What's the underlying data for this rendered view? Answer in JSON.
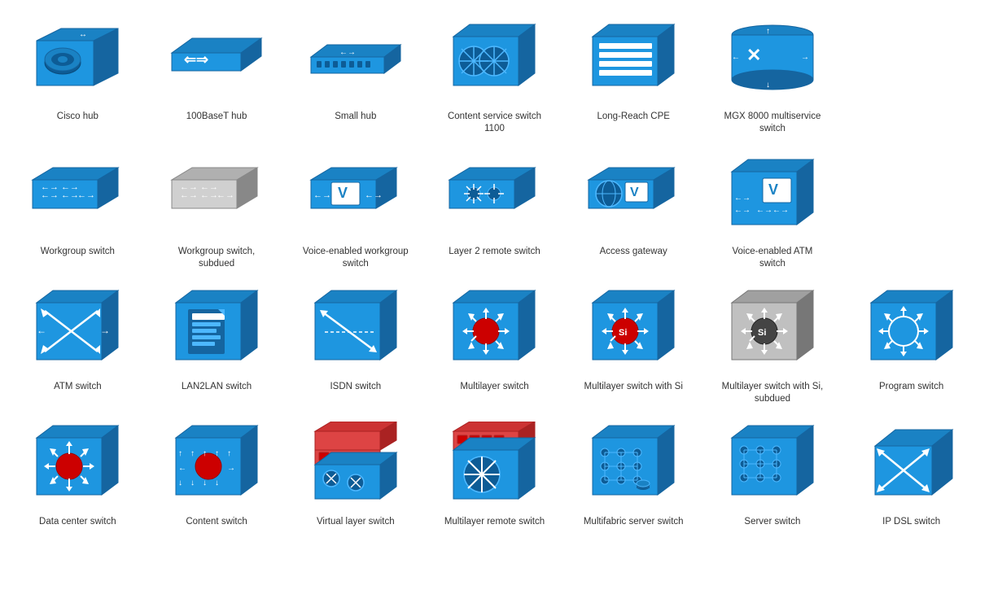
{
  "items": [
    {
      "id": "cisco-hub",
      "label": "Cisco hub",
      "type": "cisco-hub"
    },
    {
      "id": "100baset-hub",
      "label": "100BaseT hub",
      "type": "100baset-hub"
    },
    {
      "id": "small-hub",
      "label": "Small hub",
      "type": "small-hub"
    },
    {
      "id": "content-service-switch-1100",
      "label": "Content service switch 1100",
      "type": "content-service-switch-1100"
    },
    {
      "id": "long-reach-cpe",
      "label": "Long-Reach CPE",
      "type": "long-reach-cpe"
    },
    {
      "id": "mgx-8000",
      "label": "MGX 8000 multiservice switch",
      "type": "mgx-8000"
    },
    {
      "id": "spacer1",
      "label": "",
      "type": "spacer"
    },
    {
      "id": "workgroup-switch",
      "label": "Workgroup switch",
      "type": "workgroup-switch"
    },
    {
      "id": "workgroup-switch-subdued",
      "label": "Workgroup switch, subdued",
      "type": "workgroup-switch-subdued"
    },
    {
      "id": "voice-enabled-workgroup-switch",
      "label": "Voice-enabled workgroup switch",
      "type": "voice-enabled-workgroup-switch"
    },
    {
      "id": "layer2-remote-switch",
      "label": "Layer 2 remote switch",
      "type": "layer2-remote-switch"
    },
    {
      "id": "access-gateway",
      "label": "Access gateway",
      "type": "access-gateway"
    },
    {
      "id": "voice-enabled-atm-switch",
      "label": "Voice-enabled ATM switch",
      "type": "voice-enabled-atm-switch"
    },
    {
      "id": "spacer2",
      "label": "",
      "type": "spacer"
    },
    {
      "id": "atm-switch",
      "label": "ATM switch",
      "type": "atm-switch"
    },
    {
      "id": "lan2lan-switch",
      "label": "LAN2LAN switch",
      "type": "lan2lan-switch"
    },
    {
      "id": "isdn-switch",
      "label": "ISDN switch",
      "type": "isdn-switch"
    },
    {
      "id": "multilayer-switch",
      "label": "Multilayer switch",
      "type": "multilayer-switch"
    },
    {
      "id": "multilayer-switch-si",
      "label": "Multilayer switch with Si",
      "type": "multilayer-switch-si"
    },
    {
      "id": "multilayer-switch-si-subdued",
      "label": "Multilayer switch with Si, subdued",
      "type": "multilayer-switch-si-subdued"
    },
    {
      "id": "program-switch",
      "label": "Program switch",
      "type": "program-switch"
    },
    {
      "id": "data-center-switch",
      "label": "Data center switch",
      "type": "data-center-switch"
    },
    {
      "id": "content-switch",
      "label": "Content switch",
      "type": "content-switch"
    },
    {
      "id": "virtual-layer-switch",
      "label": "Virtual layer switch",
      "type": "virtual-layer-switch"
    },
    {
      "id": "multilayer-remote-switch",
      "label": "Multilayer remote switch",
      "type": "multilayer-remote-switch"
    },
    {
      "id": "multifabric-server-switch",
      "label": "Multifabric server switch",
      "type": "multifabric-server-switch"
    },
    {
      "id": "server-switch",
      "label": "Server switch",
      "type": "server-switch"
    },
    {
      "id": "ip-dsl-switch",
      "label": "IP DSL switch",
      "type": "ip-dsl-switch"
    }
  ]
}
